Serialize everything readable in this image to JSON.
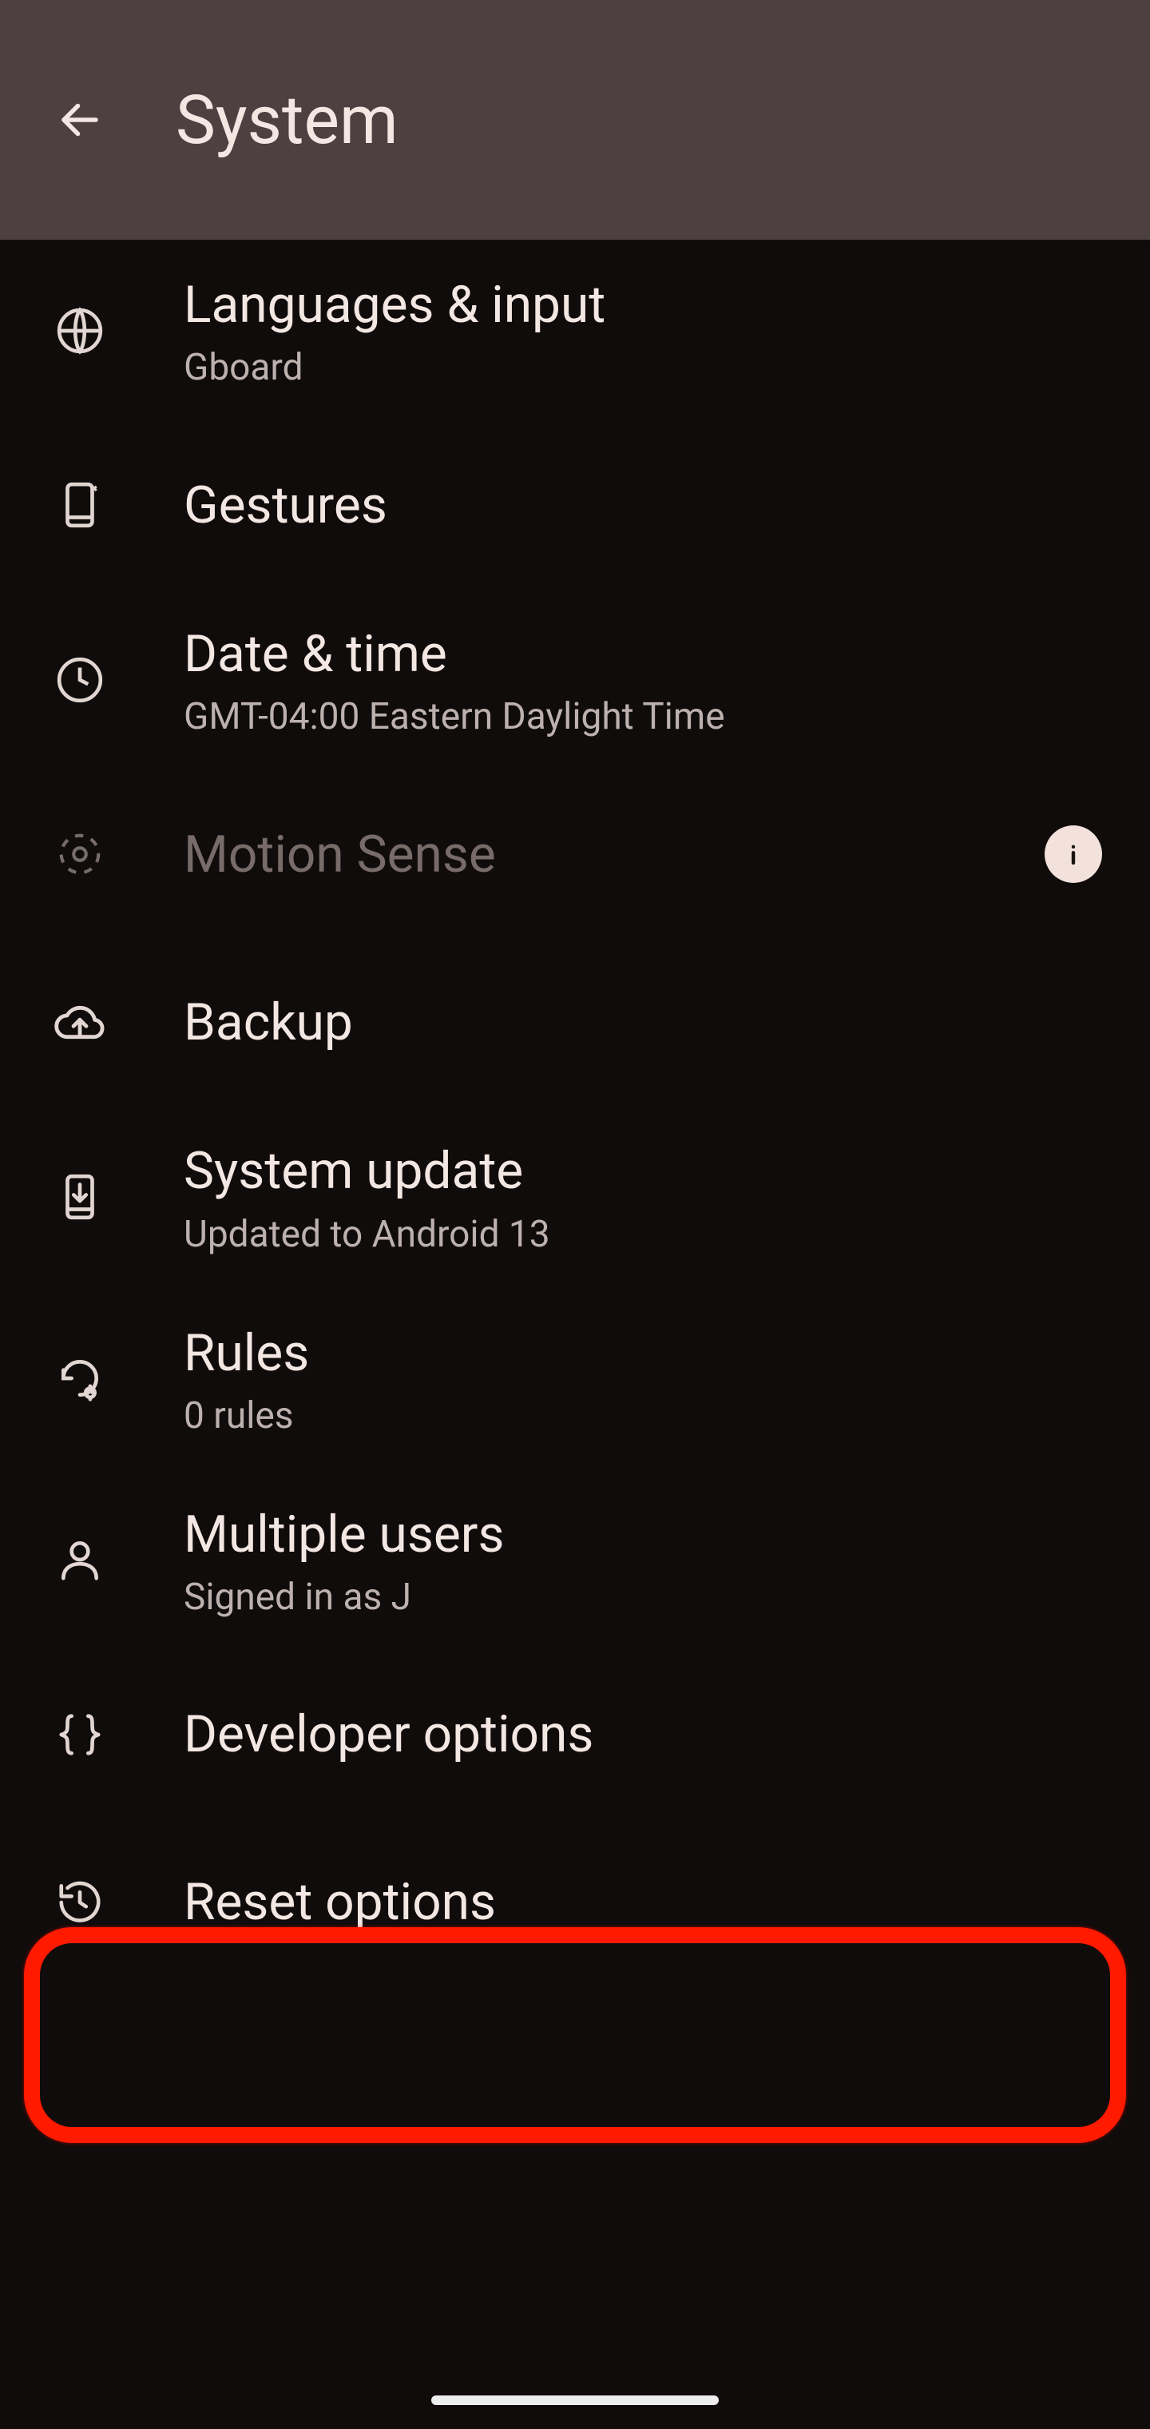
{
  "header": {
    "title": "System"
  },
  "items": {
    "languages": {
      "title": "Languages & input",
      "sub": "Gboard"
    },
    "gestures": {
      "title": "Gestures"
    },
    "datetime": {
      "title": "Date & time",
      "sub": "GMT-04:00 Eastern Daylight Time"
    },
    "motion": {
      "title": "Motion Sense"
    },
    "backup": {
      "title": "Backup"
    },
    "update": {
      "title": "System update",
      "sub": "Updated to Android 13"
    },
    "rules": {
      "title": "Rules",
      "sub": "0 rules"
    },
    "users": {
      "title": "Multiple users",
      "sub": "Signed in as J"
    },
    "developer": {
      "title": "Developer options"
    },
    "reset": {
      "title": "Reset options"
    }
  }
}
